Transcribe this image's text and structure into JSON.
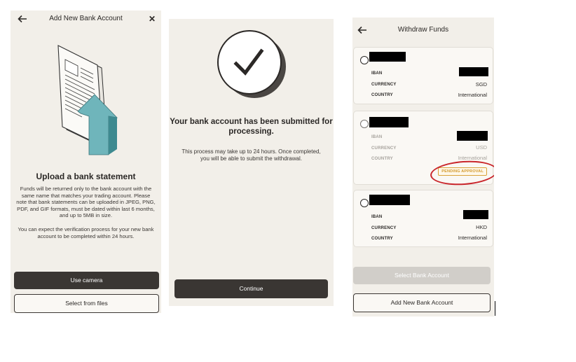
{
  "screen1": {
    "title": "Add New Bank Account",
    "heading": "Upload a bank statement",
    "body1": "Funds will be returned only to the bank account with the same name that matches your trading account. Please note that bank statements can be uploaded in JPEG, PNG, PDF, and GIF formats, must be dated within last 6 months, and up to 5MB in size.",
    "body2": "You can expect the verification process for your new bank account to be completed within 24 hours.",
    "camera_button": "Use camera",
    "files_button": "Select from files",
    "icons": {
      "back": "arrow-left-icon",
      "close": "close-icon",
      "illustration": "document-upload-illustration"
    }
  },
  "screen2": {
    "heading": "Your bank account has been submitted for processing.",
    "body": "This process may take up to 24 hours. Once completed, you will be able to submit the withdrawal.",
    "continue_button": "Continue",
    "icons": {
      "success": "checkmark-circle-icon"
    }
  },
  "screen3": {
    "title": "Withdraw Funds",
    "accounts": [
      {
        "iban_label": "IBAN",
        "currency_label": "CURRENCY",
        "currency": "SGD",
        "country_label": "COUNTRY",
        "country": "International",
        "status": ""
      },
      {
        "iban_label": "IBAN",
        "currency_label": "CURRENCY",
        "currency": "USD",
        "country_label": "COUNTRY",
        "country": "International",
        "status": "PENDING APPROVAL"
      },
      {
        "iban_label": "IBAN",
        "currency_label": "CURRENCY",
        "currency": "HKD",
        "country_label": "COUNTRY",
        "country": "International",
        "status": ""
      }
    ],
    "select_button": "Select Bank Account",
    "add_button": "Add New Bank Account",
    "icons": {
      "back": "arrow-left-icon",
      "radio": "radio-unchecked-icon"
    }
  },
  "colors": {
    "background": "#f2efe9",
    "button_dark": "#3a3633",
    "pending": "#d39a2e",
    "annotation": "#c9262b",
    "illustration_accent": "#6fb5bb"
  }
}
